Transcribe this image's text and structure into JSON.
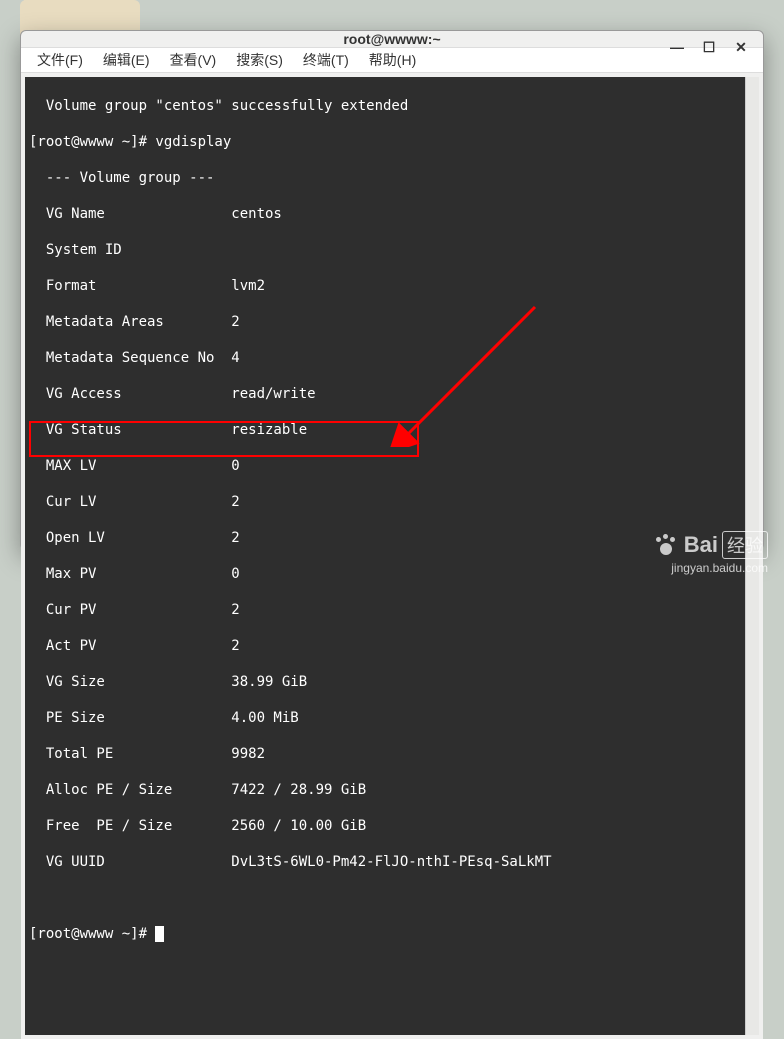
{
  "window": {
    "title": "root@wwww:~",
    "min": "—",
    "max": "☐",
    "close": "✕"
  },
  "menu": {
    "file": "文件(F)",
    "edit": "编辑(E)",
    "view": "查看(V)",
    "search": "搜索(S)",
    "terminal": "终端(T)",
    "help": "帮助(H)"
  },
  "terminal": {
    "l0": "  Volume group \"centos\" successfully extended",
    "l1": "[root@wwww ~]# vgdisplay",
    "l2": "  --- Volume group ---",
    "l3": "  VG Name               centos",
    "l4": "  System ID",
    "l5": "  Format                lvm2",
    "l6": "  Metadata Areas        2",
    "l7": "  Metadata Sequence No  4",
    "l8": "  VG Access             read/write",
    "l9": "  VG Status             resizable",
    "l10": "  MAX LV                0",
    "l11": "  Cur LV                2",
    "l12": "  Open LV               2",
    "l13": "  Max PV                0",
    "l14": "  Cur PV                2",
    "l15": "  Act PV                2",
    "l16": "  VG Size               38.99 GiB",
    "l17": "  PE Size               4.00 MiB",
    "l18": "  Total PE              9982",
    "l19": "  Alloc PE / Size       7422 / 28.99 GiB",
    "l20": "  Free  PE / Size       2560 / 10.00 GiB",
    "l21": "  VG UUID               DvL3tS-6WL0-Pm42-FlJO-nthI-PEsq-SaLkMT",
    "prompt2": "[root@wwww ~]# "
  },
  "watermark": {
    "logo_a": "Bai",
    "logo_b": "经验",
    "url": "jingyan.baidu.com"
  }
}
